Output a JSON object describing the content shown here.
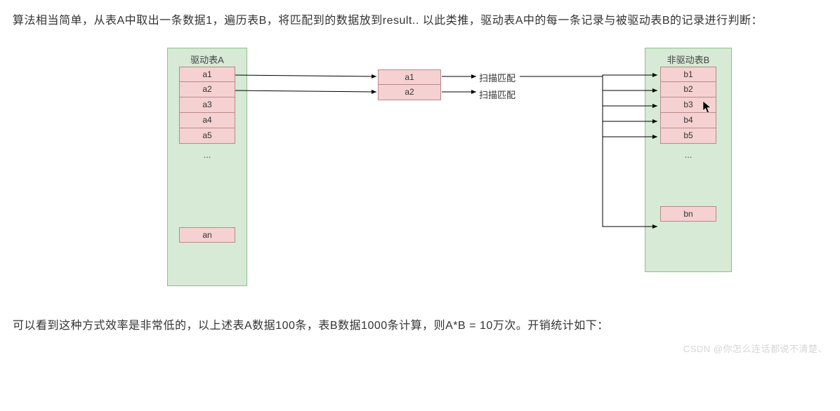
{
  "para_top": "算法相当简单，从表A中取出一条数据1，遍历表B，将匹配到的数据放到result.. 以此类推，驱动表A中的每一条记录与被驱动表B的记录进行判断：",
  "para_bottom": "可以看到这种方式效率是非常低的，以上述表A数据100条，表B数据1000条计算，则A*B = 10万次。开销统计如下：",
  "panelA": {
    "title": "驱动表A",
    "cells": [
      "a1",
      "a2",
      "a3",
      "a4",
      "a5"
    ],
    "dots": "...",
    "last": "an"
  },
  "panelB": {
    "title": "非驱动表B",
    "cells": [
      "b1",
      "b2",
      "b3",
      "b4",
      "b5"
    ],
    "dots": "...",
    "last": "bn"
  },
  "mid": {
    "cells": [
      "a1",
      "a2"
    ]
  },
  "scan1": "扫描匹配",
  "scan2": "扫描匹配",
  "watermark": "CSDN @你怎么连话都说不清楚、"
}
